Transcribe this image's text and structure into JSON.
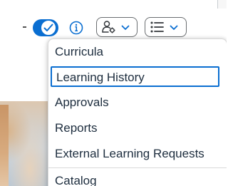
{
  "toolbar": {
    "toggle_state": "on",
    "icons": {
      "toggle": "checkmark-toggle-icon",
      "info": "info-icon",
      "people": "people-settings-icon",
      "list": "list-icon",
      "chevron": "chevron-down-icon"
    }
  },
  "menu": {
    "items": [
      {
        "label": "Curricula"
      },
      {
        "label": "Learning History"
      },
      {
        "label": "Approvals"
      },
      {
        "label": "Reports"
      },
      {
        "label": "External Learning Requests"
      },
      {
        "label": "Catalog"
      }
    ],
    "focused_index": 1
  },
  "colors": {
    "accent": "#0a6ed1",
    "text": "#1d2d3e",
    "border": "#6a6d70"
  }
}
